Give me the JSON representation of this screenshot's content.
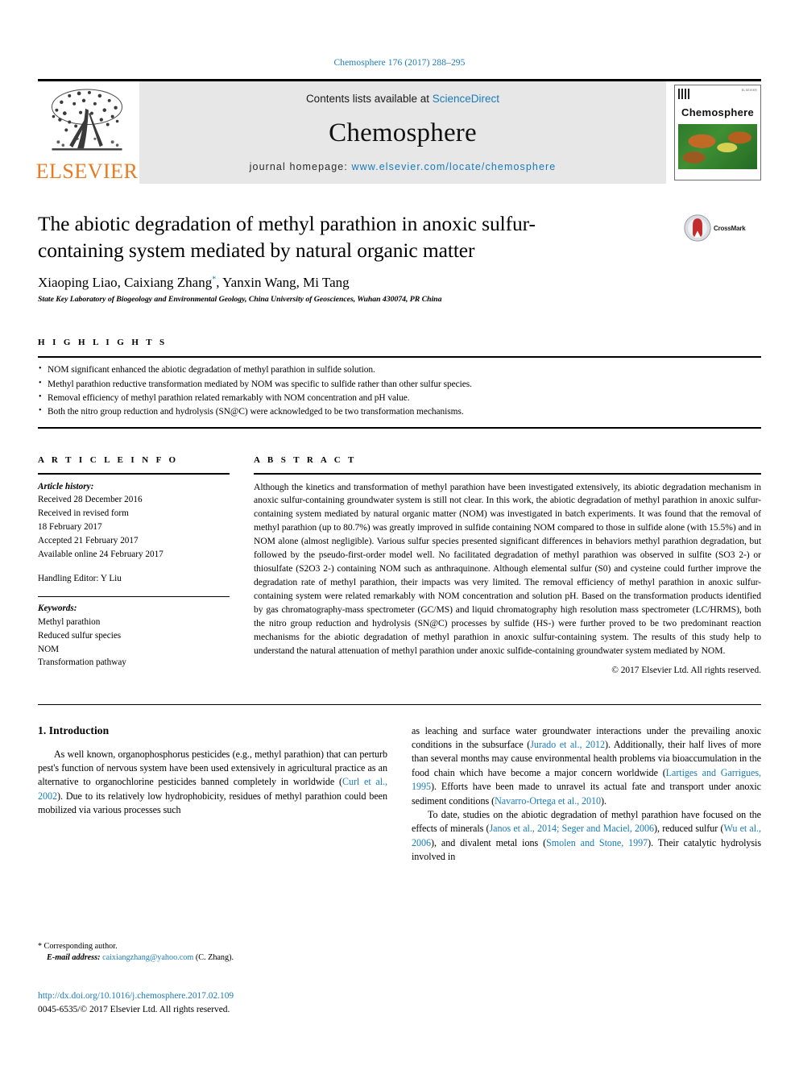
{
  "running_head": "Chemosphere 176 (2017) 288–295",
  "masthead": {
    "contents_prefix": "Contents lists available at ",
    "contents_link": "ScienceDirect",
    "journal_name": "Chemosphere",
    "homepage_prefix": "journal homepage: ",
    "homepage_url": "www.elsevier.com/locate/chemosphere",
    "publisher_logo_text": "ELSEVIER",
    "cover": {
      "title": "Chemosphere",
      "publisher_mark": "ELSEVIER"
    }
  },
  "article": {
    "title": "The abiotic degradation of methyl parathion in anoxic sulfur-containing system mediated by natural organic matter",
    "authors": "Xiaoping Liao, Caixiang Zhang",
    "authors_rest": ", Yanxin Wang, Mi Tang",
    "corresponding_marker": "*",
    "affiliation": "State Key Laboratory of Biogeology and Environmental Geology, China University of Geosciences, Wuhan 430074, PR China",
    "crossmark_label": "CrossMark"
  },
  "highlights": {
    "heading": "H I G H L I G H T S",
    "items": [
      "NOM significant enhanced the abiotic degradation of methyl parathion in sulfide solution.",
      "Methyl parathion reductive transformation mediated by NOM was specific to sulfide rather than other sulfur species.",
      "Removal efficiency of methyl parathion related remarkably with NOM concentration and pH value.",
      "Both the nitro group reduction and hydrolysis (SN@C) were acknowledged to be two transformation mechanisms."
    ]
  },
  "article_info": {
    "heading": "A R T I C L E   I N F O",
    "history_label": "Article history:",
    "history": [
      "Received 28 December 2016",
      "Received in revised form",
      "18 February 2017",
      "Accepted 21 February 2017",
      "Available online 24 February 2017"
    ],
    "handling_editor": "Handling Editor: Y Liu",
    "keywords_label": "Keywords:",
    "keywords": [
      "Methyl parathion",
      "Reduced sulfur species",
      "NOM",
      "Transformation pathway"
    ]
  },
  "abstract": {
    "heading": "A B S T R A C T",
    "text": "Although the kinetics and transformation of methyl parathion have been investigated extensively, its abiotic degradation mechanism in anoxic sulfur-containing groundwater system is still not clear. In this work, the abiotic degradation of methyl parathion in anoxic sulfur-containing system mediated by natural organic matter (NOM) was investigated in batch experiments. It was found that the removal of methyl parathion (up to 80.7%) was greatly improved in sulfide containing NOM compared to those in sulfide alone (with 15.5%) and in NOM alone (almost negligible). Various sulfur species presented significant differences in behaviors methyl parathion degradation, but followed by the pseudo-first-order model well. No facilitated degradation of methyl parathion was observed in sulfite (SO3 2-) or thiosulfate (S2O3 2-) containing NOM such as anthraquinone. Although elemental sulfur (S0) and cysteine could further improve the degradation rate of methyl parathion, their impacts was very limited. The removal efficiency of methyl parathion in anoxic sulfur-containing system were related remarkably with NOM concentration and solution pH. Based on the transformation products identified by gas chromatography-mass spectrometer (GC/MS) and liquid chromatography high resolution mass spectrometer (LC/HRMS), both the nitro group reduction and hydrolysis (SN@C) processes by sulfide (HS-) were further proved to be two predominant reaction mechanisms for the abiotic degradation of methyl parathion in anoxic sulfur-containing system. The results of this study help to understand the natural attenuation of methyl parathion under anoxic sulfide-containing groundwater system mediated by NOM.",
    "copyright": "© 2017 Elsevier Ltd. All rights reserved."
  },
  "body": {
    "section_number_title": "1. Introduction",
    "left_paragraph_1": "As well known, organophosphorus pesticides (e.g., methyl parathion) that can perturb pest's function of nervous system have been used extensively in agricultural practice as an alternative to organochlorine pesticides banned completely in worldwide (",
    "left_cite_1": "Curl et al., 2002",
    "left_paragraph_1_cont": "). Due to its relatively low hydrophobicity, residues of methyl parathion could been mobilized via various processes such",
    "right_paragraph_1a": "as leaching and surface water groundwater interactions under the prevailing anoxic conditions in the subsurface (",
    "right_cite_1": "Jurado et al., 2012",
    "right_paragraph_1b": "). Additionally, their half lives of more than several months may cause environmental health problems via bioaccumulation in the food chain which have become a major concern worldwide (",
    "right_cite_2": "Lartiges and Garrigues, 1995",
    "right_paragraph_1c": "). Efforts have been made to unravel its actual fate and transport under anoxic sediment conditions (",
    "right_cite_3": "Navarro-Ortega et al., 2010",
    "right_paragraph_1d": ").",
    "right_paragraph_2a": "To date, studies on the abiotic degradation of methyl parathion have focused on the effects of minerals (",
    "right_cite_4": "Janos et al., 2014; Seger and Maciel, 2006",
    "right_paragraph_2b": "), reduced sulfur (",
    "right_cite_5": "Wu et al., 2006",
    "right_paragraph_2c": "), and divalent metal ions (",
    "right_cite_6": "Smolen and Stone, 1997",
    "right_paragraph_2d": "). Their catalytic hydrolysis involved in"
  },
  "footer": {
    "corresponding_label": "Corresponding author.",
    "email_label": "E-mail address:",
    "email": "caixiangzhang@yahoo.com",
    "email_owner": "(C. Zhang).",
    "doi": "http://dx.doi.org/10.1016/j.chemosphere.2017.02.109",
    "issn_line": "0045-6535/© 2017 Elsevier Ltd. All rights reserved."
  },
  "colors": {
    "link": "#1a7bb9",
    "elsevier_orange": "#e77b22",
    "banner_bg": "#e7e7e7"
  }
}
